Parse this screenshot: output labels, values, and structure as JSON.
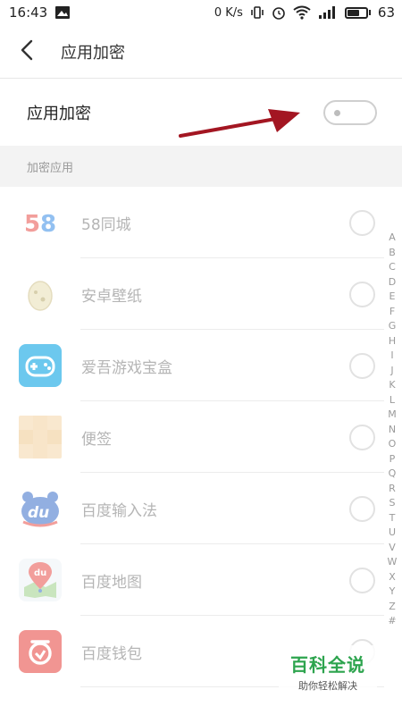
{
  "status_bar": {
    "time": "16:43",
    "net_speed": "0 K/s",
    "battery": "63",
    "icons": [
      "image-icon",
      "vibrate-icon",
      "alarm-icon",
      "wifi-icon",
      "signal-icon",
      "battery-icon"
    ]
  },
  "title_bar": {
    "back_icon": "chevron-left-icon",
    "title": "应用加密"
  },
  "main_toggle": {
    "label": "应用加密",
    "enabled": false
  },
  "section": {
    "header": "加密应用"
  },
  "apps": [
    {
      "name": "58同城",
      "icon": "58-icon",
      "checked": false
    },
    {
      "name": "安卓壁纸",
      "icon": "egg-icon",
      "checked": false
    },
    {
      "name": "爱吾游戏宝盒",
      "icon": "gamepad-icon",
      "checked": false
    },
    {
      "name": "便签",
      "icon": "note-icon",
      "checked": false
    },
    {
      "name": "百度输入法",
      "icon": "du-icon",
      "checked": false
    },
    {
      "name": "百度地图",
      "icon": "map-icon",
      "checked": false
    },
    {
      "name": "百度钱包",
      "icon": "wallet-icon",
      "checked": false
    }
  ],
  "alpha_index": [
    "A",
    "B",
    "C",
    "D",
    "E",
    "F",
    "G",
    "H",
    "I",
    "J",
    "K",
    "L",
    "M",
    "N",
    "O",
    "P",
    "Q",
    "R",
    "S",
    "T",
    "U",
    "V",
    "W",
    "X",
    "Y",
    "Z",
    "#"
  ],
  "watermark": {
    "title": "百科全说",
    "subtitle": "助你轻松解决"
  },
  "colors": {
    "arrow": "#a31622",
    "watermark_green": "#2da44e"
  }
}
